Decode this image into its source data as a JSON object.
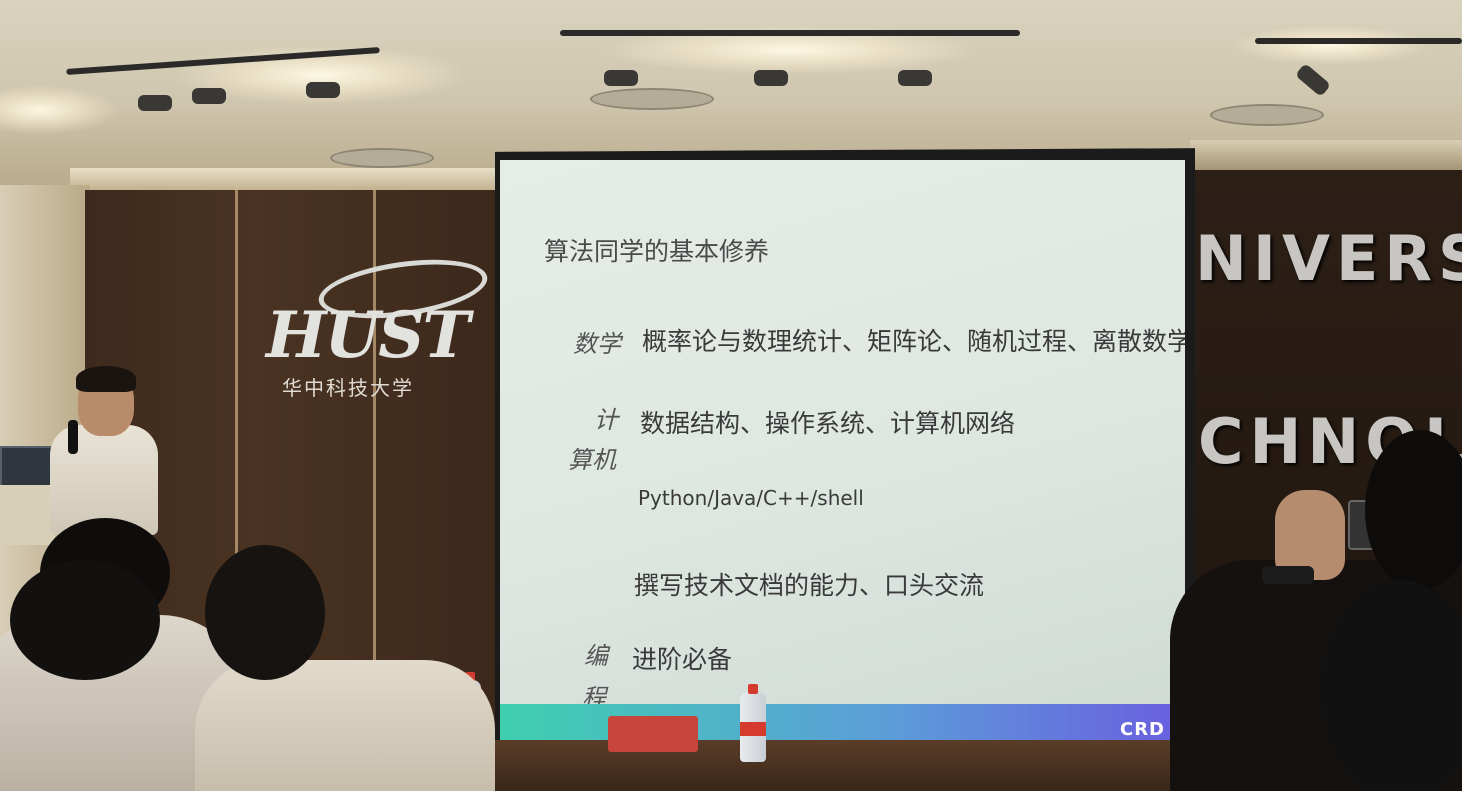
{
  "slide": {
    "title": "算法同学的基本修养",
    "rows": [
      {
        "label": "数学",
        "content": "概率论与数理统计、矩阵论、随机过程、离散数学"
      },
      {
        "label_line1": "计",
        "label_line2": "算机",
        "content": "数据结构、操作系统、计算机网络"
      },
      {
        "content": "Python/Java/C++/shell"
      },
      {
        "content": "撰写技术文档的能力、口头交流"
      },
      {
        "label_line1": "编",
        "label_line2": "程",
        "content": "进阶必备"
      }
    ],
    "footer_logo": "CRD"
  },
  "venue": {
    "logo_mark": "HUST",
    "logo_text": "华中科技大学",
    "wall_text_line1": "NIVERS",
    "wall_text_line2": "CHNOL"
  },
  "colors": {
    "screen": "#e2e9e3",
    "slide_bar_start": "#3fcfb0",
    "slide_bar_end": "#6a5ee0",
    "wood": "#4a3322"
  }
}
